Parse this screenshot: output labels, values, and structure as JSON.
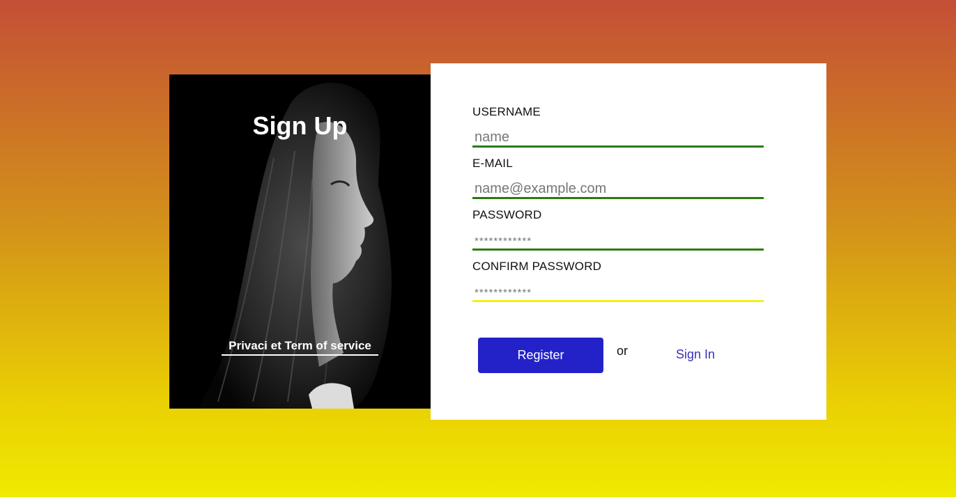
{
  "hero": {
    "title": "Sign Up",
    "terms_link": "Privaci et Term of service"
  },
  "form": {
    "fields": [
      {
        "label": "USERNAME",
        "placeholder": "name",
        "type": "text"
      },
      {
        "label": "E-MAIL",
        "placeholder": "name@example.com",
        "type": "email"
      },
      {
        "label": "PASSWORD",
        "placeholder": "************",
        "type": "password"
      },
      {
        "label": "CONFIRM PASSWORD",
        "placeholder": "************",
        "type": "password"
      }
    ],
    "register_label": "Register",
    "or_text": "or",
    "signin_label": "Sign In"
  },
  "colors": {
    "background_top": "#c44f36",
    "background_bottom": "#f0ea00",
    "field_underline": "#2b7a0b",
    "field_underline_focus": "#f7ee1a",
    "register_button": "#2322c8",
    "signin_link": "#3a30b8"
  }
}
